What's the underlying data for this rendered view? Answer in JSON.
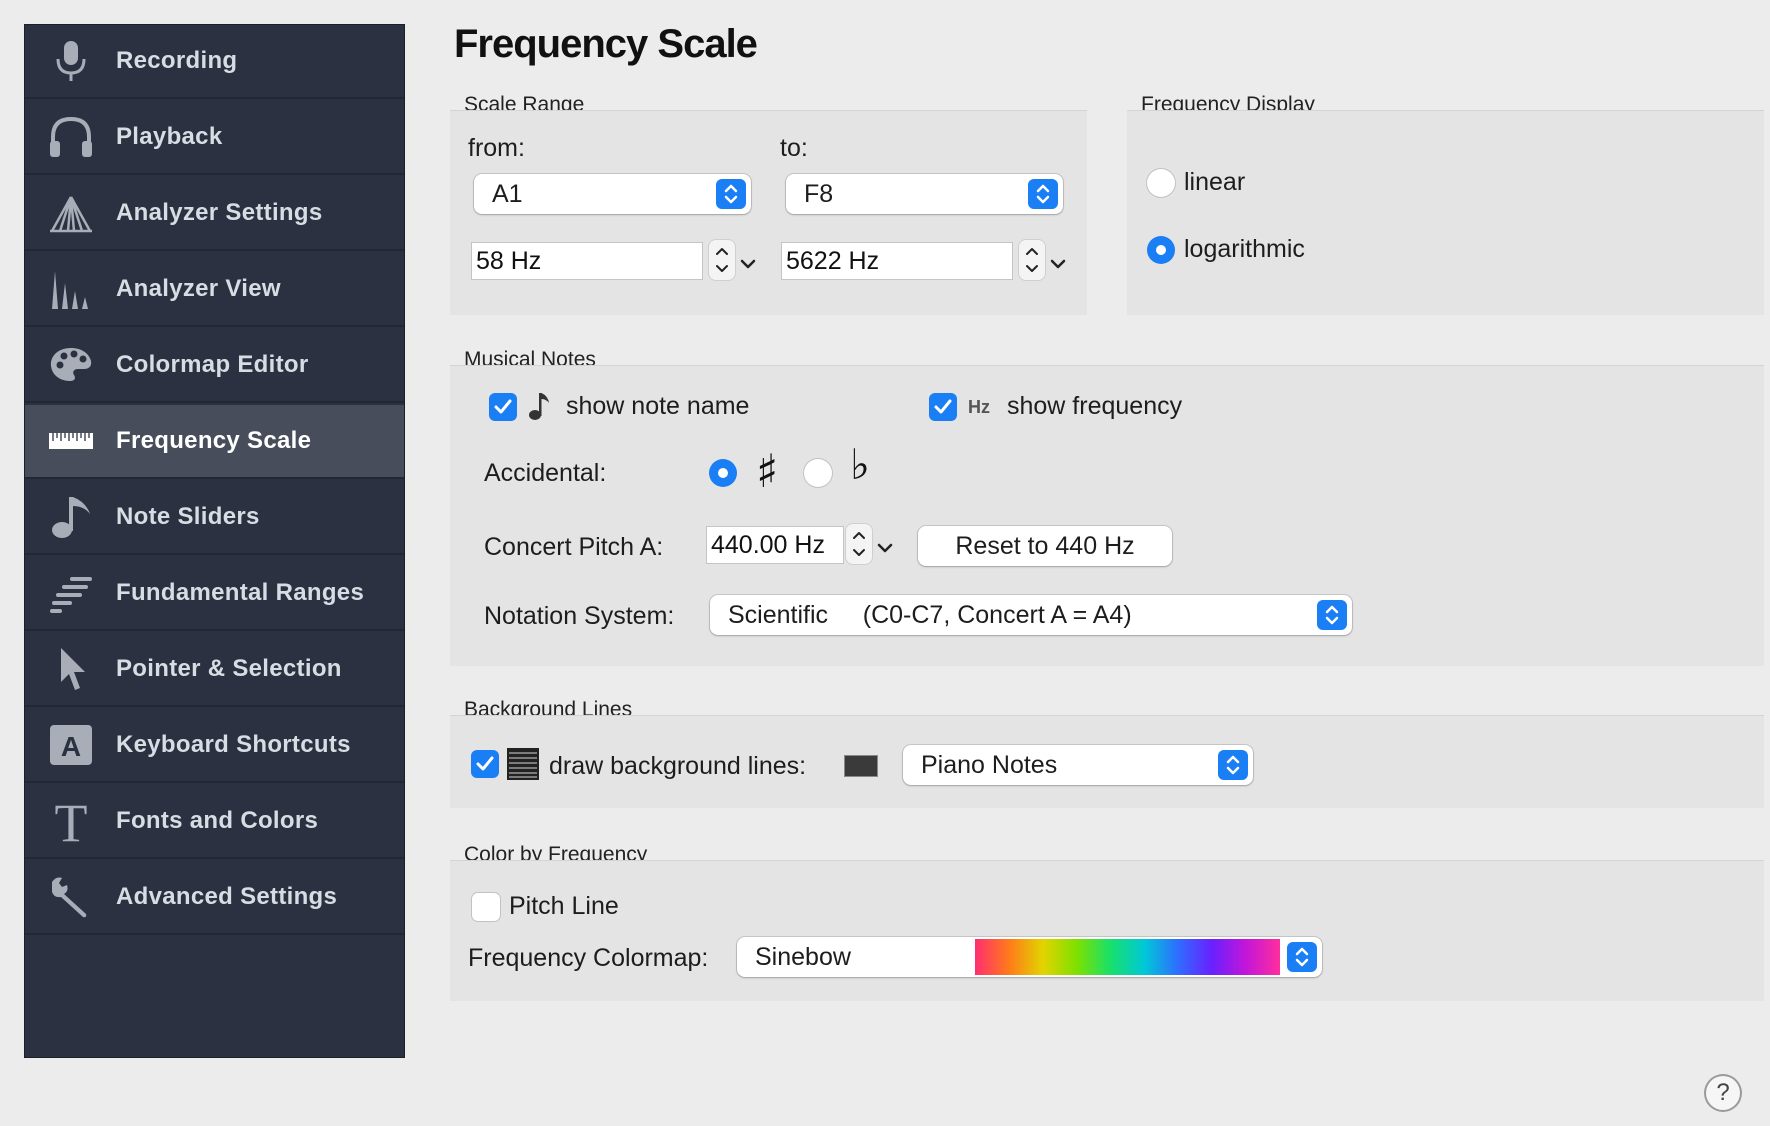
{
  "sidebar": {
    "items": [
      {
        "label": "Recording",
        "icon": "microphone-icon"
      },
      {
        "label": "Playback",
        "icon": "headphones-icon"
      },
      {
        "label": "Analyzer Settings",
        "icon": "spectrum-fan-icon"
      },
      {
        "label": "Analyzer View",
        "icon": "spectrum-peaks-icon"
      },
      {
        "label": "Colormap Editor",
        "icon": "palette-icon"
      },
      {
        "label": "Frequency Scale",
        "icon": "ruler-icon",
        "selected": true
      },
      {
        "label": "Note Sliders",
        "icon": "music-note-icon"
      },
      {
        "label": "Fundamental Ranges",
        "icon": "ranges-bars-icon"
      },
      {
        "label": "Pointer & Selection",
        "icon": "pointer-arrow-icon"
      },
      {
        "label": "Keyboard Shortcuts",
        "icon": "keyboard-a-icon"
      },
      {
        "label": "Fonts and Colors",
        "icon": "font-t-icon"
      },
      {
        "label": "Advanced Settings",
        "icon": "wrench-icon"
      }
    ]
  },
  "page_title": "Frequency Scale",
  "scale_range": {
    "title": "Scale Range",
    "from_label": "from:",
    "to_label": "to:",
    "from_note": "A1",
    "to_note": "F8",
    "from_hz": "58 Hz",
    "to_hz": "5622 Hz"
  },
  "frequency_display": {
    "title": "Frequency Display",
    "options": [
      "linear",
      "logarithmic"
    ],
    "selected": "logarithmic"
  },
  "musical_notes": {
    "title": "Musical Notes",
    "show_note_name": "show note name",
    "show_note_name_checked": true,
    "hz_tag": "Hz",
    "show_frequency": "show frequency",
    "show_frequency_checked": true,
    "accidental_label": "Accidental:",
    "accidental_selected": "sharp",
    "sharp_glyph": "♯",
    "flat_glyph": "♭",
    "concert_pitch_label": "Concert Pitch A:",
    "concert_pitch_value": "440.00 Hz",
    "reset_button": "Reset to 440 Hz",
    "notation_label": "Notation System:",
    "notation_value": "Scientific     (C0-C7, Concert A = A4)"
  },
  "background_lines": {
    "title": "Background Lines",
    "checked": true,
    "label": "draw background lines:",
    "line_color": "#3a3a3a",
    "style_value": "Piano Notes"
  },
  "color_by_frequency": {
    "title": "Color by Frequency",
    "pitch_line_label": "Pitch Line",
    "pitch_line_checked": false,
    "colormap_label": "Frequency Colormap:",
    "colormap_value": "Sinebow"
  },
  "colors": {
    "accent": "#1a7ef5",
    "sidebar_bg": "#2b3140",
    "sidebar_selected": "#474d5b"
  },
  "help_button": "?"
}
